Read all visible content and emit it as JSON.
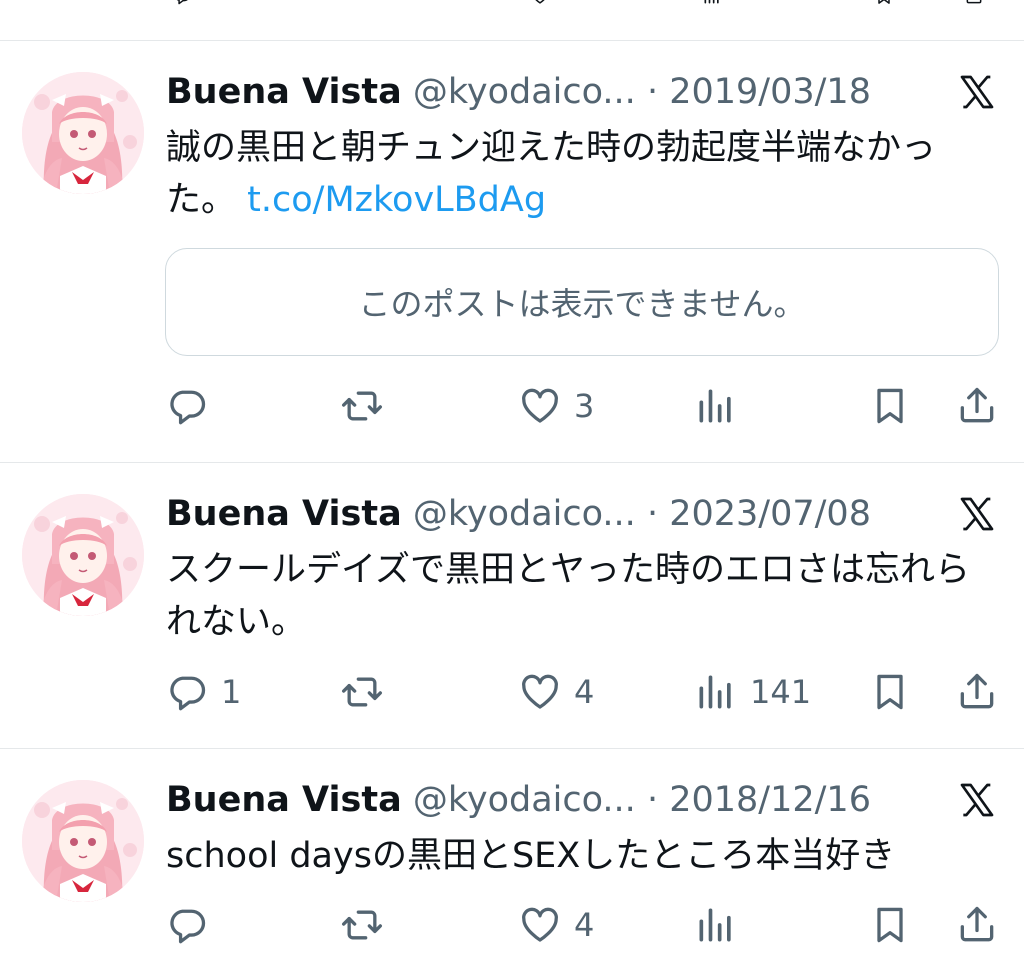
{
  "icons": {
    "reply": "speech-bubble-outline",
    "repost": "two-arrows-loop",
    "like": "heart-outline",
    "views": "bar-chart",
    "bookmark": "bookmark-outline",
    "share": "upload-arrow",
    "brand": "x-logo"
  },
  "colors": {
    "text": "#0f1419",
    "secondary": "#536471",
    "link": "#1d9bf0",
    "border": "#cfd9de"
  },
  "tweets": [
    {
      "name": "Buena Vista",
      "handle": "@kyodaico...",
      "dot": "·",
      "date": "2019/03/18",
      "text": "誠の黒田と朝チュン迎えた時の勃起度半端なかった。",
      "link": "t.co/MzkovLBdAg",
      "card": "このポストは表示できません。",
      "counts": {
        "reply": "",
        "repost": "",
        "like": "3",
        "views": ""
      }
    },
    {
      "name": "Buena Vista",
      "handle": "@kyodaico...",
      "dot": "·",
      "date": "2023/07/08",
      "text": "スクールデイズで黒田とヤった時のエロさは忘れられない。",
      "counts": {
        "reply": "1",
        "repost": "",
        "like": "4",
        "views": "141"
      }
    },
    {
      "name": "Buena Vista",
      "handle": "@kyodaico...",
      "dot": "·",
      "date": "2018/12/16",
      "text": "school daysの黒田とSEXしたところ本当好き",
      "counts": {
        "reply": "",
        "repost": "",
        "like": "4",
        "views": ""
      }
    }
  ]
}
